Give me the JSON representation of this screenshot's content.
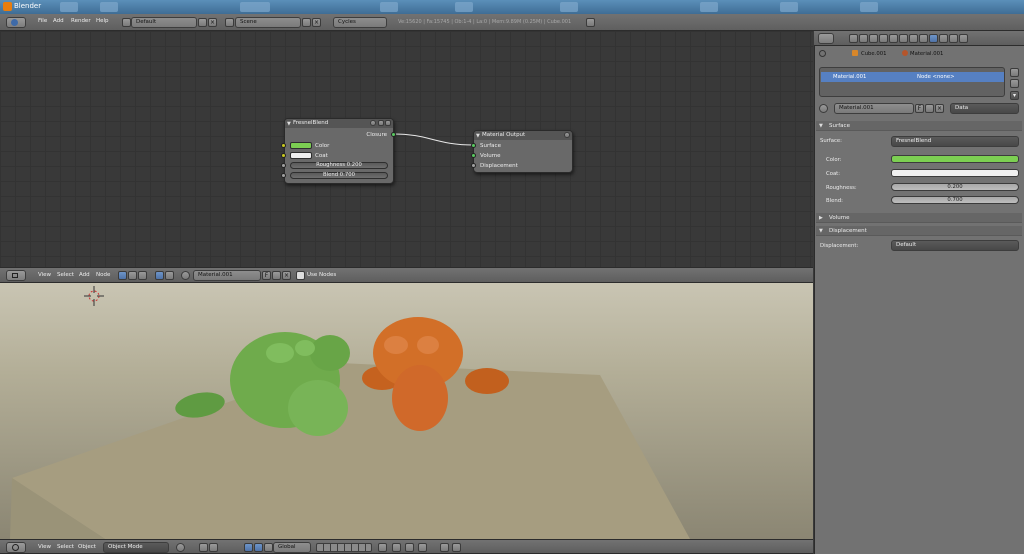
{
  "window": {
    "title": "Blender"
  },
  "topbar": {
    "menus": [
      "File",
      "Add",
      "Render",
      "Help"
    ],
    "screen_layout": "Default",
    "scene": "Scene",
    "engine": "Cycles",
    "stats": "Ve:15620 | Fa:15745 | Ob:1-4 | La:0 | Mem:9.89M (0.25M) | Cube.001"
  },
  "node_editor": {
    "fresnel_node": {
      "title": "FresnelBlend",
      "output": "Closure",
      "color_label": "Color",
      "coat_label": "Coat",
      "roughness": "Roughness 0.200",
      "blend": "Blend 0.700"
    },
    "output_node": {
      "title": "Material Output",
      "inputs": [
        "Surface",
        "Volume",
        "Displacement"
      ]
    },
    "header": {
      "menus": [
        "View",
        "Select",
        "Add",
        "Node"
      ],
      "material": "Material.001",
      "fake_user": "F",
      "use_nodes_label": "Use Nodes"
    }
  },
  "viewport": {
    "menus": [
      "View",
      "Select",
      "Object"
    ],
    "mode": "Object Mode",
    "orientation": "Global"
  },
  "properties": {
    "breadcrumb_object": "Cube.001",
    "breadcrumb_material": "Material.001",
    "slot_material": "Material.001",
    "slot_node": "Node <none>",
    "material_field": "Material.001",
    "fake_user": "F",
    "link": "Data",
    "sections": {
      "surface": "Surface",
      "volume": "Volume",
      "displacement": "Displacement"
    },
    "surface_label": "Surface:",
    "surface_value": "FresnelBlend",
    "color_label": "Color:",
    "coat_label": "Coat:",
    "roughness_label": "Roughness:",
    "roughness_value": "0.200",
    "blend_label": "Blend:",
    "blend_value": "0.700",
    "displacement_label": "Displacement:",
    "displacement_value": "Default"
  },
  "colors": {
    "green_color": "#7ccf52",
    "coat_color": "#f0f0f0",
    "selected_slot": "#5680c2",
    "socket_yellow": "#c8c820",
    "socket_green": "#58c860",
    "socket_gray": "#a0a0a0"
  },
  "icons": [
    "blender-icon",
    "editor-type-icon",
    "grid-icon",
    "close-icon",
    "material-sphere-icon",
    "cursor-crosshair-icon",
    "camera-icon",
    "render-icon",
    "checkbox-icon"
  ]
}
